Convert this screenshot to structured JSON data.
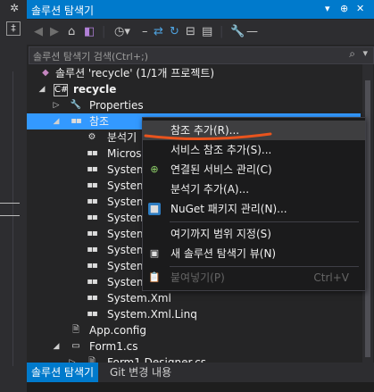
{
  "window": {
    "title": "솔루션 탐색기",
    "title_buttons": [
      "▾",
      "⊕",
      "✕"
    ]
  },
  "toolbar": {
    "icons": [
      "back-icon",
      "forward-icon",
      "home-icon",
      "vs-icon",
      "history-icon",
      "sync-icon",
      "refresh-icon",
      "collapse-icon",
      "show-all-icon",
      "wrench-icon",
      "properties-dash-icon"
    ]
  },
  "search": {
    "placeholder": "솔루션 탐색기 검색(Ctrl+;)",
    "icon": "search-icon"
  },
  "tree": {
    "solution": "솔루션 'recycle' (1/1개 프로젝트)",
    "project": "recycle",
    "properties": "Properties",
    "references": "참조",
    "reference_items": [
      "분석기",
      "Micros",
      "System",
      "System",
      "System",
      "System",
      "System",
      "System",
      "System",
      "System",
      "System.Xml",
      "System.Xml.Linq"
    ],
    "app_config": "App.config",
    "form1": "Form1.cs",
    "form1_designer": "Form1.Designer.cs"
  },
  "context_menu": {
    "items": [
      {
        "label": "참조 추가(R)...",
        "icon": "",
        "shortcut": ""
      },
      {
        "label": "서비스 참조 추가(S)...",
        "icon": "",
        "shortcut": ""
      },
      {
        "label": "연결된 서비스 관리(C)",
        "icon": "connected-service-icon",
        "shortcut": ""
      },
      {
        "label": "분석기 추가(A)...",
        "icon": "",
        "shortcut": ""
      },
      {
        "label": "NuGet 패키지 관리(N)...",
        "icon": "nuget-icon",
        "shortcut": ""
      },
      {
        "label": "여기까지 범위 지정(S)",
        "icon": "",
        "shortcut": ""
      },
      {
        "label": "새 솔루션 탐색기 뷰(N)",
        "icon": "new-view-icon",
        "shortcut": ""
      },
      {
        "label": "붙여넣기(P)",
        "icon": "paste-icon",
        "shortcut": "Ctrl+V"
      }
    ]
  },
  "tabs": [
    "솔루션 탐색기",
    "Git 변경 내용"
  ],
  "colors": {
    "accent": "#007acc",
    "selection": "#3399ff",
    "annotation_stroke": "#e8541e"
  }
}
